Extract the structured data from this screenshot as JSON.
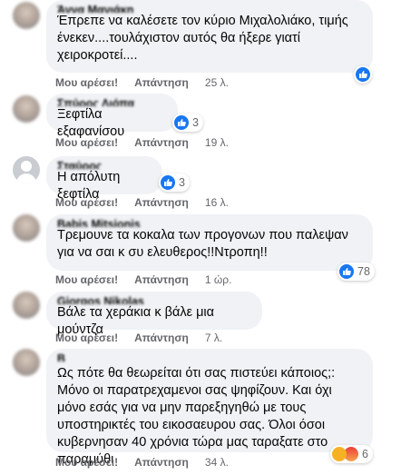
{
  "labels": {
    "like": "Μου αρέσει!",
    "reply": "Απάντηση"
  },
  "comments": [
    {
      "name": "Άννα Μανιάκη",
      "text": "Έπρεπε να καλέσετε τον κύριο Μιχαλολιάκο, τιμής ένεκεν....τουλάχιστον αυτός θα ήξερε γιατί χειροκροτεί....",
      "time": "25 λ.",
      "reactions": [
        "like"
      ],
      "count": ""
    },
    {
      "name": "Σπύρος Λιόπα",
      "text": "Ξεφτίλα εξαφανίσου",
      "time": "19 λ.",
      "reactions": [
        "like"
      ],
      "count": "3"
    },
    {
      "name": "Σταύρος Κατσίκης",
      "text": "Η απόλυτη ξεφτίλα",
      "time": "16 λ.",
      "reactions": [
        "like"
      ],
      "count": "3"
    },
    {
      "name": "Babis Mitsionis",
      "text": "Τρεμουνε τα κοκαλα των προγονων που παλεψαν για να σαι κ συ ελευθερος!!Ντροπη!!",
      "time": "1 ώρ.",
      "reactions": [
        "like"
      ],
      "count": "78"
    },
    {
      "name": "Giorgos Nikolas",
      "text": "Βάλε τα χεράκια κ βάλε μια μούντζα",
      "time": "7 λ.",
      "reactions": [],
      "count": ""
    },
    {
      "name": "Β",
      "text": "Ως πότε θα θεωρείται ότι σας πιστεύει κάποιος;: Μόνο οι παρατρεχαμενοι σας ψηφίζουν. Και όχι μόνο εσάς για να μην παρεξηγηθώ με τους υποστηρικτές του εικοσαευρου σας. Όλοι όσοι κυβερνησαν 40 χρόνια τώρα μας ταραξατε στο παραμύθι",
      "time": "34 λ.",
      "reactions": [
        "haha",
        "angry"
      ],
      "count": "6"
    }
  ],
  "colors": {
    "bubble": "#f0f2f5",
    "meta": "#65676b",
    "like_blue": "#1877f2"
  }
}
